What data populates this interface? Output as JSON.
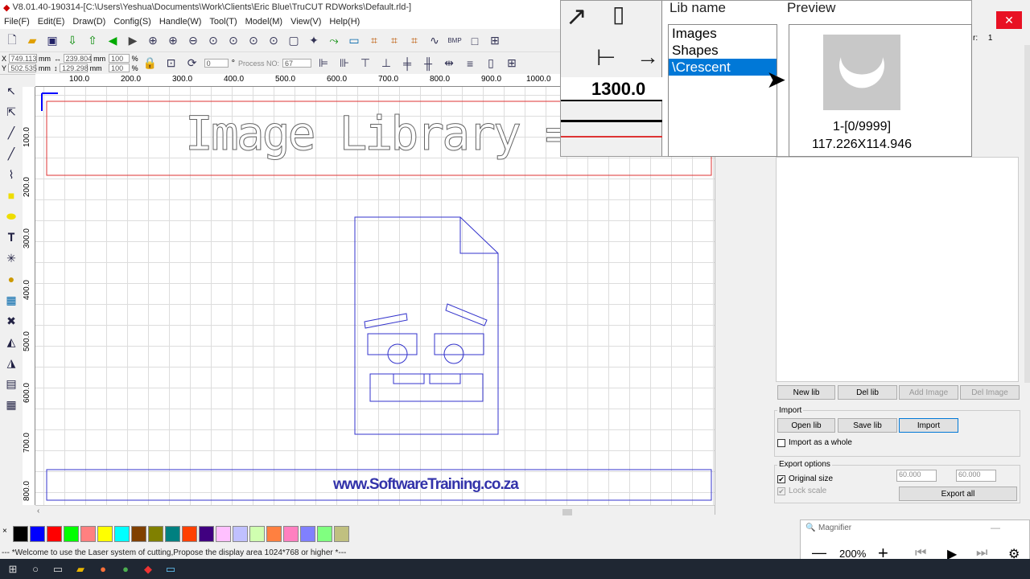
{
  "window_title": "V8.01.40-190314-[C:\\Users\\Yeshua\\Documents\\Work\\Clients\\Eric Blue\\TruCUT RDWorks\\Default.rld-]",
  "menu": [
    "File(F)",
    "Edit(E)",
    "Draw(D)",
    "Config(S)",
    "Handle(W)",
    "Tool(T)",
    "Model(M)",
    "View(V)",
    "Help(H)"
  ],
  "coords": {
    "x_label": "X",
    "x_val": "749.113",
    "y_label": "Y",
    "y_val": "502.535",
    "unit": "mm",
    "w_val": "239.804",
    "h_val": "129.298",
    "pct1": "100",
    "pct2": "100",
    "pct_sign": "%",
    "rot_val": "0",
    "deg": "°",
    "process_label": "Process NO:",
    "process_val": "67"
  },
  "ruler_top": [
    "100.0",
    "200.0",
    "300.0",
    "400.0",
    "500.0",
    "600.0",
    "700.0",
    "800.0",
    "900.0",
    "1000.0"
  ],
  "ruler_left": [
    "100.0",
    "200.0",
    "300.0",
    "400.0",
    "500.0",
    "600.0",
    "700.0",
    "800.0"
  ],
  "canvas": {
    "heading": "Image Library = Add Images",
    "footer": "www.SoftwareTraining.co.za"
  },
  "palette": {
    "x_label": "×",
    "colors": [
      "#000000",
      "#0000ff",
      "#ff0000",
      "#00ff00",
      "#ff8080",
      "#ffff00",
      "#00ffff",
      "#804000",
      "#808000",
      "#008080",
      "#ff4000",
      "#400080",
      "#ffc0ff",
      "#c0c0ff",
      "#d0ffb0",
      "#ff8040",
      "#ff80c0",
      "#8080ff",
      "#80ff80",
      "#c0c080"
    ]
  },
  "status": "--- *Welcome to use the Laser system of cutting,Propose the display area 1024*768 or higher *---",
  "magnifier_view": {
    "lib_name_label": "Lib name",
    "preview_label": "Preview",
    "libs": [
      "Images",
      "Shapes",
      "\\Crescent"
    ],
    "selected_lib": 2,
    "ruler_value": "1300.0",
    "preview_index": "1-[0/9999]",
    "preview_size": "117.226X114.946"
  },
  "right_panel": {
    "layer_label": "r:",
    "layer_val": "1",
    "buttons": [
      "New lib",
      "Del lib",
      "Add Image",
      "Del Image"
    ],
    "import_label": "Import",
    "import_buttons": [
      "Open lib",
      "Save lib",
      "Import"
    ],
    "import_whole": "Import as a whole",
    "export_label": "Export options",
    "original_size": "Original size",
    "lock_scale": "Lock scale",
    "w": "60.000",
    "h": "60.000",
    "export_all": "Export all",
    "close": "✕"
  },
  "magnifier_bar": {
    "title": "Magnifier",
    "zoom": "200%"
  }
}
